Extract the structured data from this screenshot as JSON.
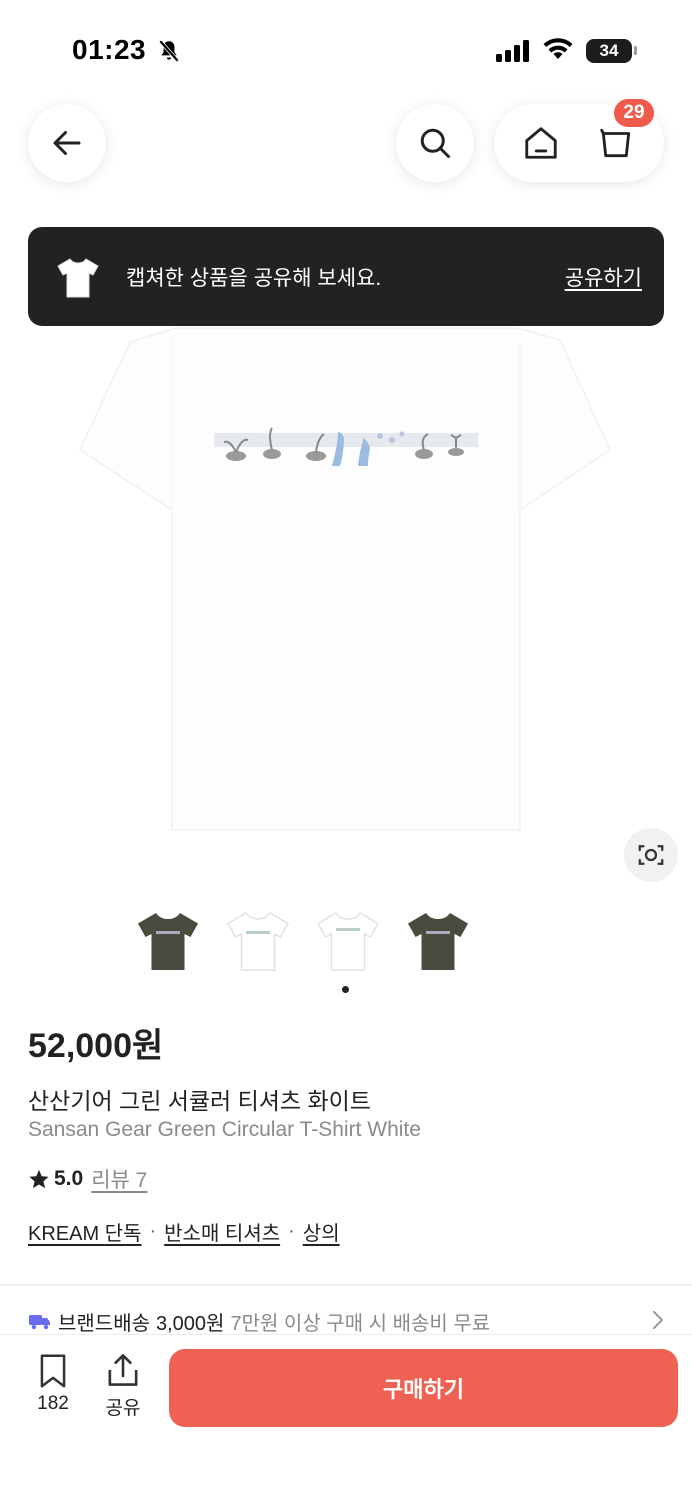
{
  "status_bar": {
    "time": "01:23",
    "battery": "34",
    "icons": [
      "bell-off-icon",
      "signal-icon",
      "wifi-icon",
      "battery-icon"
    ]
  },
  "nav": {
    "icons": [
      "back-arrow-icon",
      "search-icon",
      "home-icon",
      "cart-icon"
    ],
    "cart_badge": "29",
    "accent_color": "#ef5a4b"
  },
  "share_toast": {
    "message": "캡쳐한 상품을 공유해 보세요.",
    "action": "공유하기"
  },
  "gallery": {
    "main_image": "white t-shirt with small plant print across chest",
    "thumbnails": [
      {
        "color": "#4a4a3f",
        "label": "brown"
      },
      {
        "color": "#ffffff",
        "label": "white"
      },
      {
        "color": "#ffffff",
        "label": "white"
      },
      {
        "color": "#4a4a3f",
        "label": "brown"
      }
    ]
  },
  "product": {
    "price": "52,000원",
    "name_ko": "산산기어 그린 서큘러 티셔츠 화이트",
    "name_en": "Sansan Gear Green Circular T-Shirt White",
    "rating": "5.0",
    "review_label": "리뷰 7",
    "tags": [
      "KREAM 단독",
      "반소매 티셔츠",
      "상의"
    ],
    "tag_separator": "·"
  },
  "shipping": {
    "label": "브랜드배송",
    "fee": "3,000원",
    "note": "7만원 이상 구매 시 배송비 무료"
  },
  "bottom_bar": {
    "bookmark_count": "182",
    "share_label": "공유",
    "buy_label": "구매하기",
    "buy_color": "#ef6253"
  }
}
